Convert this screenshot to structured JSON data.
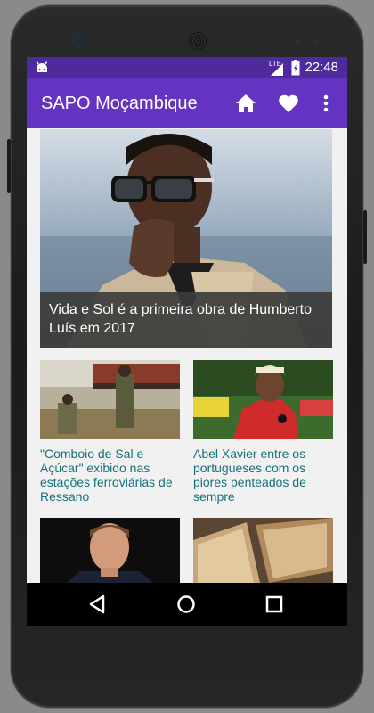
{
  "status_bar": {
    "time": "22:48",
    "network_label": "LTE",
    "icons": [
      "android-notification-icon",
      "lte-signal-icon",
      "battery-icon"
    ]
  },
  "app_bar": {
    "title": "SAPO Moçambique",
    "actions": [
      "home-icon",
      "heart-icon",
      "more-vert-icon"
    ]
  },
  "featured": {
    "caption": "Vida e Sol é a primeira obra de Humberto Luís em 2017"
  },
  "articles": [
    {
      "title": "\"Comboio de Sal e Açúcar\" exibido nas estações ferroviárias de Ressano"
    },
    {
      "title": "Abel Xavier entre os portugueses com os piores penteados de sempre"
    },
    {
      "title": ""
    },
    {
      "title": ""
    }
  ],
  "nav_bar": {
    "buttons": [
      "back-icon",
      "home-circle-icon",
      "recents-icon"
    ]
  },
  "colors": {
    "status_bar": "#4e2a9c",
    "app_bar": "#6433c2",
    "link_text": "#17707a"
  }
}
